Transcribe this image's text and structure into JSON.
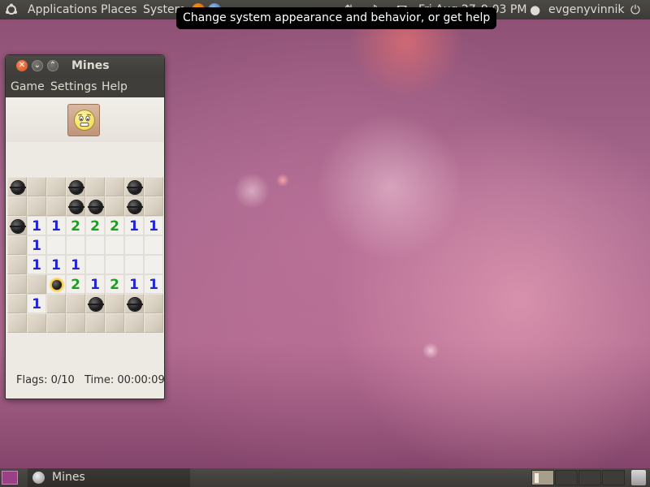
{
  "top_panel": {
    "menus": [
      "Applications",
      "Places",
      "System"
    ],
    "date": "Fri Aug 27",
    "time": "9:03 PM",
    "user": "evgenyvinnik"
  },
  "tooltip": "Change system appearance and behavior, or get help",
  "window": {
    "title": "Mines",
    "menu": [
      "Game",
      "Settings",
      "Help"
    ],
    "face_state": "worried-face",
    "status": {
      "flags": "Flags: 0/10",
      "time": "Time: 00:00:09"
    },
    "board": {
      "rows": 8,
      "cols": 8,
      "cells": [
        [
          "M",
          "c",
          "c",
          "M",
          "c",
          "c",
          "M",
          "c"
        ],
        [
          "c",
          "c",
          "c",
          "M",
          "M",
          "c",
          "M",
          "c"
        ],
        [
          "M",
          "1",
          "1",
          "2",
          "2",
          "2",
          "1",
          "1"
        ],
        [
          "c",
          "1",
          "o",
          "o",
          "o",
          "o",
          "o",
          "o"
        ],
        [
          "c",
          "1",
          "1",
          "1",
          "o",
          "o",
          "o",
          "o"
        ],
        [
          "c",
          "c",
          "X",
          "2",
          "1",
          "2",
          "1",
          "1"
        ],
        [
          "c",
          "1",
          "c",
          "c",
          "M",
          "c",
          "M",
          "c"
        ],
        [
          "c",
          "c",
          "c",
          "c",
          "c",
          "c",
          "c",
          "c"
        ]
      ]
    }
  },
  "bottom_panel": {
    "task_label": "Mines",
    "workspaces": 4
  },
  "colors": {
    "panel": "#3d3c38",
    "number_1": "#2323d8",
    "number_2": "#1e9e1e",
    "close_button": "#e0602a"
  }
}
